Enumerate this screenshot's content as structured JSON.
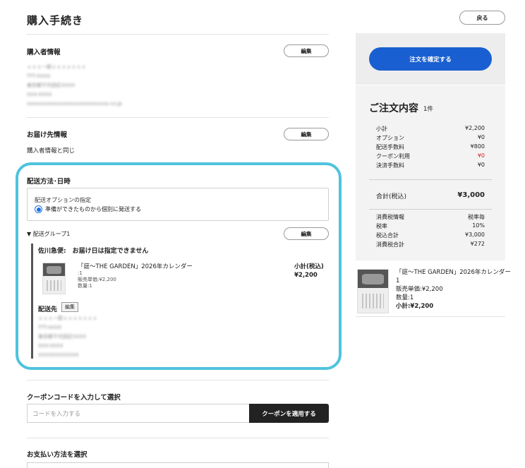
{
  "header": {
    "title": "購入手続き",
    "back_label": "戻る"
  },
  "purchaser": {
    "title": "購入者情報",
    "edit_label": "編集",
    "blurred_lines": [
      "ｘｘｘ一郎ｘｘｘｘｘｘｘ",
      "TTT-XXXX",
      "東京都千代田区XXXX",
      "XXX-XXXX",
      "xxxxxxxxxxxxxxxxxxxxxxxxxxxx.co.jp"
    ]
  },
  "delivery_address": {
    "title": "お届け先情報",
    "edit_label": "編集",
    "value": "購入者情報と同じ"
  },
  "shipping": {
    "title": "配送方法･日時",
    "option_label": "配送オプションの指定",
    "option_value": "準備ができたものから個別に発送する",
    "group_label": "▼ 配送グループ1",
    "group_edit_label": "編集",
    "carrier_text": "佐川急便:　お届け日は指定できません",
    "item": {
      "name": "「庭～THE GARDEN」2026年カレンダー",
      "line2": ":1",
      "unit_price": "販売単価:¥2,200",
      "quantity": "数量:1",
      "subtotal_label": "小計(税込)",
      "subtotal_value": "¥2,200"
    },
    "destination_label": "配送先",
    "destination_edit_label": "編集",
    "destination_blurred": [
      "ｘｘｘ一郎ｘｘｘｘｘｘｘ",
      "TTT-XXXX",
      "東京都千代田区XXXX",
      "XXX-XXXX",
      "XXXXXXXXXXXX"
    ]
  },
  "coupon": {
    "title": "クーポンコードを入力して選択",
    "placeholder": "コードを入力する",
    "apply_label": "クーポンを適用する"
  },
  "payment": {
    "title": "お支払い方法を選択"
  },
  "order": {
    "confirm_label": "注文を確定する",
    "title": "ご注文内容",
    "count": "1件",
    "rows": [
      {
        "label": "小計",
        "value": "¥2,200"
      },
      {
        "label": "オプション",
        "value": "¥0"
      },
      {
        "label": "配送手数料",
        "value": "¥800"
      },
      {
        "label": "クーポン利用",
        "value": "¥0"
      },
      {
        "label": "決済手数料",
        "value": "¥0"
      }
    ],
    "total_label": "合計(税込)",
    "total_value": "¥3,000",
    "tax_rows": [
      {
        "label": "消費税情報",
        "value": "税率毎"
      },
      {
        "label": "税率",
        "value": "10%"
      },
      {
        "label": "税込合計",
        "value": "¥3,000"
      },
      {
        "label": "消費税合計",
        "value": "¥272"
      }
    ],
    "product": {
      "name": "「庭～THE GARDEN」2026年カレンダー",
      "line2": "1",
      "unit_price": "販売単価:¥2,200",
      "quantity": "数量:1",
      "subtotal": "小計:¥2,200"
    }
  },
  "colors": {
    "accent": "#1a5fd1",
    "highlight": "#4ec3dd",
    "danger": "#d6202a",
    "dark_button": "#222222"
  }
}
